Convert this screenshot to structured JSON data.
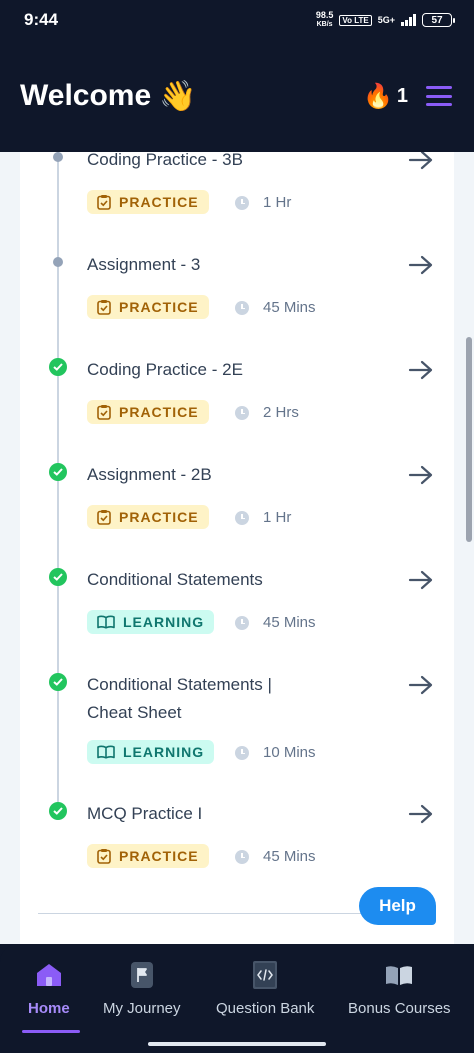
{
  "status_bar": {
    "time": "9:44",
    "net_speed_top": "98.5",
    "net_speed_unit": "KB/s",
    "volte": "Vo LTE",
    "network": "5G+",
    "battery": "57"
  },
  "header": {
    "title": "Welcome",
    "wave_emoji": "👋",
    "streak_emoji": "🔥",
    "streak_count": "1"
  },
  "items": [
    {
      "title": "Coding Practice - 3B",
      "badge": "PRACTICE",
      "duration": "1 Hr",
      "status": "pending"
    },
    {
      "title": "Assignment - 3",
      "badge": "PRACTICE",
      "duration": "45 Mins",
      "status": "pending"
    },
    {
      "title": "Coding Practice - 2E",
      "badge": "PRACTICE",
      "duration": "2 Hrs",
      "status": "done"
    },
    {
      "title": "Assignment - 2B",
      "badge": "PRACTICE",
      "duration": "1 Hr",
      "status": "done"
    },
    {
      "title": "Conditional Statements",
      "badge": "LEARNING",
      "duration": "45 Mins",
      "status": "done"
    },
    {
      "title_line1": "Conditional Statements |",
      "title_line2": "Cheat Sheet",
      "badge": "LEARNING",
      "duration": "10 Mins",
      "status": "done"
    },
    {
      "title": "MCQ Practice I",
      "badge": "PRACTICE",
      "duration": "45 Mins",
      "status": "done"
    }
  ],
  "help_button": "Help",
  "bottom_nav": [
    {
      "label": "Home",
      "active": true
    },
    {
      "label": "My Journey",
      "active": false
    },
    {
      "label": "Question Bank",
      "active": false
    },
    {
      "label": "Bonus Courses",
      "active": false
    }
  ],
  "colors": {
    "header_bg": "#0f172a",
    "accent": "#8b5cf6",
    "done": "#22c55e",
    "help": "#1d8cf0"
  }
}
